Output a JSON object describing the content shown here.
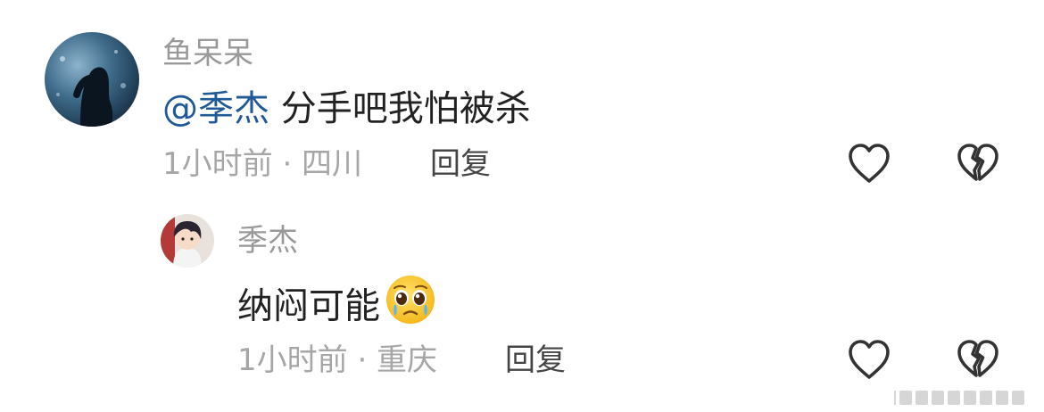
{
  "comments": [
    {
      "username": "鱼呆呆",
      "mention": "@季杰",
      "text": " 分手吧我怕被杀",
      "time_location": "1小时前 · 四川",
      "reply_label": "回复"
    },
    {
      "username": "季杰",
      "text": "纳闷可能",
      "emoji": "pleading-face-crying",
      "time_location": "1小时前 · 重庆",
      "reply_label": "回复"
    }
  ],
  "icons": {
    "like": "heart-outline-icon",
    "dislike": "broken-heart-icon"
  },
  "colors": {
    "mention": "#1f5a96",
    "meta": "#a6a6a6",
    "text": "#222222"
  }
}
